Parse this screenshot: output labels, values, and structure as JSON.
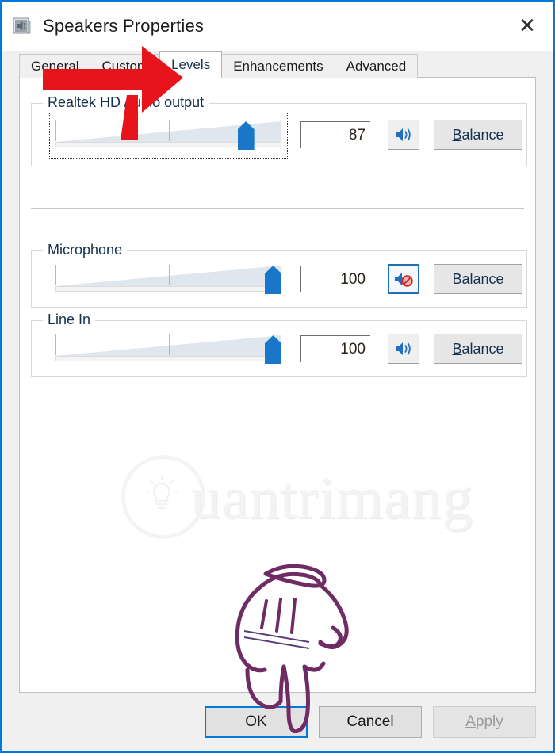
{
  "window": {
    "title": "Speakers Properties",
    "icon": "speaker-properties-icon",
    "close_label": "✕",
    "border_color": "#0078d7"
  },
  "tabs": [
    {
      "label": "General",
      "active": false
    },
    {
      "label": "Custom",
      "active": false
    },
    {
      "label": "Levels",
      "active": true
    },
    {
      "label": "Enhancements",
      "active": false
    },
    {
      "label": "Advanced",
      "active": false
    }
  ],
  "levels": {
    "groups": [
      {
        "title": "Realtek HD Audio output",
        "value": "87",
        "slider_percent": 87,
        "muted": false,
        "mute_icon": "speaker-on-icon",
        "mute_focused": false,
        "slider_focused": true,
        "balance_label": "Balance",
        "balance_accesskey": "B"
      },
      {
        "title": "Microphone",
        "value": "100",
        "slider_percent": 100,
        "muted": true,
        "mute_icon": "speaker-muted-icon",
        "mute_focused": true,
        "slider_focused": false,
        "balance_label": "Balance",
        "balance_accesskey": "B"
      },
      {
        "title": "Line In",
        "value": "100",
        "slider_percent": 100,
        "muted": false,
        "mute_icon": "speaker-on-icon",
        "mute_focused": false,
        "slider_focused": false,
        "balance_label": "Balance",
        "balance_accesskey": "B"
      }
    ]
  },
  "watermark": {
    "text": "uantrimang",
    "initial": "Q",
    "full_text": "Quantrimang"
  },
  "annotations": {
    "arrow_color": "#e8141b",
    "arrow_target": "Levels",
    "hand_color": "#6f2b63"
  },
  "footer": {
    "ok_label": "OK",
    "cancel_label": "Cancel",
    "apply_label": "Apply",
    "apply_accesskey": "A",
    "apply_enabled": false
  }
}
